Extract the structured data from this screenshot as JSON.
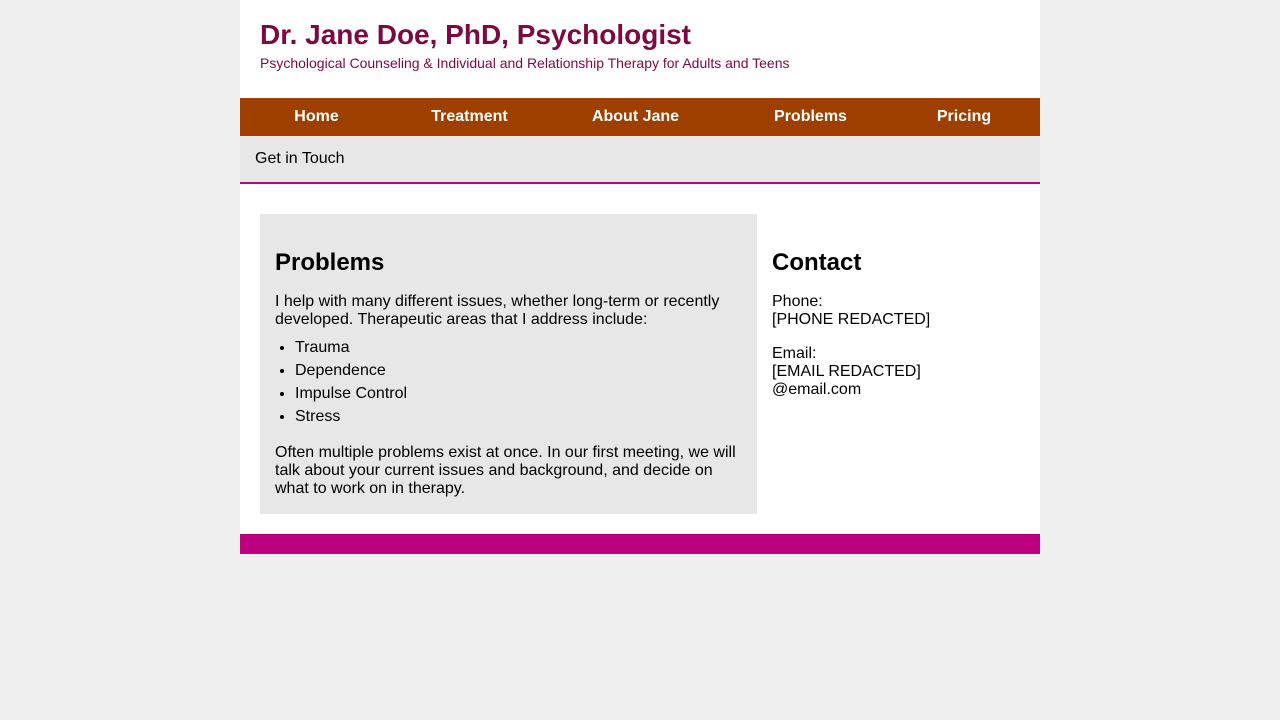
{
  "header": {
    "title": "Dr. Jane Doe, PhD, Psychologist",
    "subtitle": "Psychological Counseling & Individual and Relationship Therapy for Adults and Teens"
  },
  "nav": {
    "items": [
      "Home",
      "Treatment",
      "About Jane",
      "Problems",
      "Pricing"
    ]
  },
  "subnav": {
    "items": [
      "Get in Touch"
    ]
  },
  "problems": {
    "heading": "Problems",
    "intro": "I help with many different issues, whether long-term or recently developed. Therapeutic areas that I address include:",
    "list": [
      "Trauma",
      "Dependence",
      "Impulse Control",
      "Stress"
    ],
    "outro": "Often multiple problems exist at once. In our first meeting, we will talk about your current issues and background, and decide on what to work on in therapy."
  },
  "contact": {
    "heading": "Contact",
    "phone_label": "Phone:",
    "phone_value": "[PHONE REDACTED]",
    "email_label": "Email:",
    "email_value_line1": "[EMAIL REDACTED]",
    "email_value_line2": "@email.com"
  },
  "colors": {
    "title": "#7c0a42",
    "nav_bg": "#9e3f00",
    "accent": "#bd007f",
    "panel_bg": "#e7e7e7",
    "page_bg": "#efefef"
  }
}
